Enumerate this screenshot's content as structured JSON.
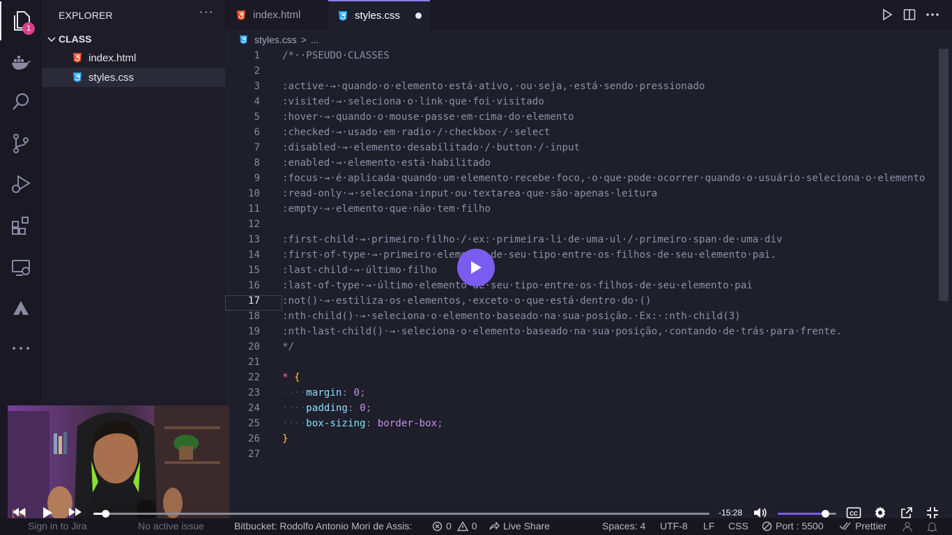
{
  "activity_bar": {
    "explorer_badge": "1"
  },
  "sidebar": {
    "title": "EXPLORER",
    "more": "···",
    "folder": "CLASS",
    "files": [
      {
        "name": "index.html",
        "icon": "html5-icon"
      },
      {
        "name": "styles.css",
        "icon": "css3-icon"
      }
    ]
  },
  "tabs": [
    {
      "label": "index.html",
      "icon": "html5-icon",
      "active": false
    },
    {
      "label": "styles.css",
      "icon": "css3-icon",
      "active": true,
      "unsaved": true
    }
  ],
  "breadcrumb": {
    "file": "styles.css",
    "sep": ">",
    "rest": "..."
  },
  "editor": {
    "current_line": 17,
    "line_numbers": [
      "1",
      "2",
      "3",
      "4",
      "5",
      "6",
      "7",
      "8",
      "9",
      "10",
      "11",
      "12",
      "13",
      "14",
      "15",
      "16",
      "17",
      "18",
      "19",
      "20",
      "21",
      "22",
      "23",
      "24",
      "25",
      "26",
      "27"
    ],
    "comment_lines": [
      "/*··PSEUDO·CLASSES",
      "",
      ":active·→·quando·o·elemento·está·ativo,·ou·seja,·está·sendo·pressionado",
      ":visited·→·seleciona·o·link·que·foi·visitado",
      ":hover·→·quando·o·mouse·passe·em·cima·do·elemento",
      ":checked·→·usado·em·radio·/·checkbox·/·select",
      ":disabled·→·elemento·desabilitado·/·button·/·input",
      ":enabled·→·elemento·está·habilitado",
      ":focus·→·é·aplicada·quando·um·elemento·recebe·foco,·o·que·pode·ocorrer·quando·o·usuário·seleciona·o·elemento",
      ":read-only·→·seleciona·input·ou·textarea·que·são·apenas·leitura",
      ":empty·→·elemento·que·não·tem·filho",
      "",
      ":first-child·→·primeiro·filho·/·ex:·primeira·li·de·uma·ul·/·primeiro·span·de·uma·div",
      ":first-of-type·→·primeiro·elemento·de·seu·tipo·entre·os·filhos·de·seu·elemento·pai.",
      ":last-child·→·último·filho",
      ":last-of-type·→·último·elemento·de·seu·tipo·entre·os·filhos·de·seu·elemento·pai",
      ":not()·→·estiliza·os·elementos,·exceto·o·que·está·dentro·do·()",
      ":nth-child()·→·seleciona·o·elemento·baseado·na·sua·posição.·Ex:·:nth-child(3)",
      ":nth-last-child()·→·seleciona·o·elemento·baseado·na·sua·posição,·contando·de·trás·para·frente.",
      "*/",
      ""
    ],
    "rule": {
      "selector": "*",
      "open": "{",
      "close": "}",
      "indent": "···",
      "declarations": [
        {
          "prop": "margin",
          "value": "0"
        },
        {
          "prop": "padding",
          "value": "0"
        },
        {
          "prop": "box-sizing",
          "value": "border-box"
        }
      ]
    }
  },
  "video": {
    "time_remaining": "-15:28",
    "progress": 0.02,
    "volume": 0.8
  },
  "statusbar": {
    "jira": "Sign in to Jira",
    "issue": "No active issue",
    "bitbucket": "Bitbucket: Rodolfo Antonio Mori de Assis:",
    "errors": "0",
    "warnings": "0",
    "live_share": "Live Share",
    "spaces": "Spaces: 4",
    "encoding": "UTF-8",
    "eol": "LF",
    "language": "CSS",
    "port": "Port : 5500",
    "prettier": "Prettier"
  },
  "colors": {
    "accent": "#7b5cf0",
    "badge": "#d5418c",
    "editor_bg": "#1f1e2b",
    "comment": "#8f8fa8",
    "selector": "#ff66b0",
    "brace": "#ffcb3d",
    "property": "#86e1ff",
    "value": "#c792ea"
  }
}
